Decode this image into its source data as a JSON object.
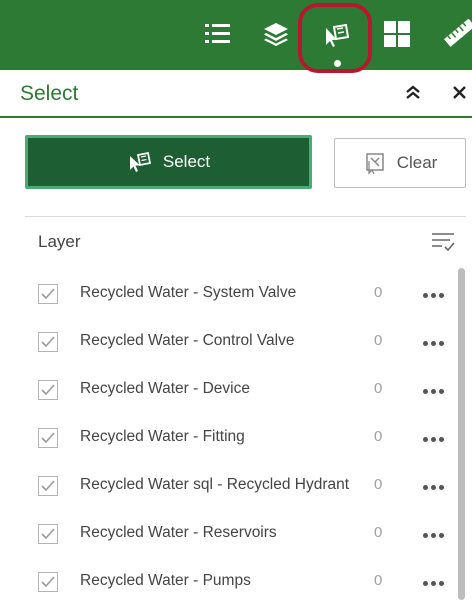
{
  "toolbar": {
    "background": "#2d7a34",
    "tools": [
      {
        "name": "layer-list",
        "icon": "list-icon"
      },
      {
        "name": "layers",
        "icon": "layers-stack-icon"
      },
      {
        "name": "select",
        "icon": "select-cursor-icon",
        "active": true
      },
      {
        "name": "basemap-gallery",
        "icon": "grid-icon"
      },
      {
        "name": "measurement",
        "icon": "ruler-icon"
      }
    ],
    "highlight_color": "#b5182f"
  },
  "panel": {
    "title": "Select",
    "actions": {
      "collapse_icon": "double-chevron-up-icon",
      "close_icon": "close-icon"
    }
  },
  "buttons": {
    "select_label": "Select",
    "clear_label": "Clear",
    "select_color": "#1e5e33"
  },
  "layers": {
    "header": "Layer",
    "options_icon": "filter-sort-icon",
    "items": [
      {
        "name": "Recycled Water - System Valve",
        "count": "0",
        "checked": true
      },
      {
        "name": "Recycled Water - Control Valve",
        "count": "0",
        "checked": true
      },
      {
        "name": "Recycled Water - Device",
        "count": "0",
        "checked": true
      },
      {
        "name": "Recycled Water - Fitting",
        "count": "0",
        "checked": true
      },
      {
        "name": "Recycled Water sql - Recycled Hydrant",
        "count": "0",
        "checked": true
      },
      {
        "name": "Recycled Water - Reservoirs",
        "count": "0",
        "checked": true
      },
      {
        "name": "Recycled Water - Pumps",
        "count": "0",
        "checked": true
      }
    ]
  }
}
